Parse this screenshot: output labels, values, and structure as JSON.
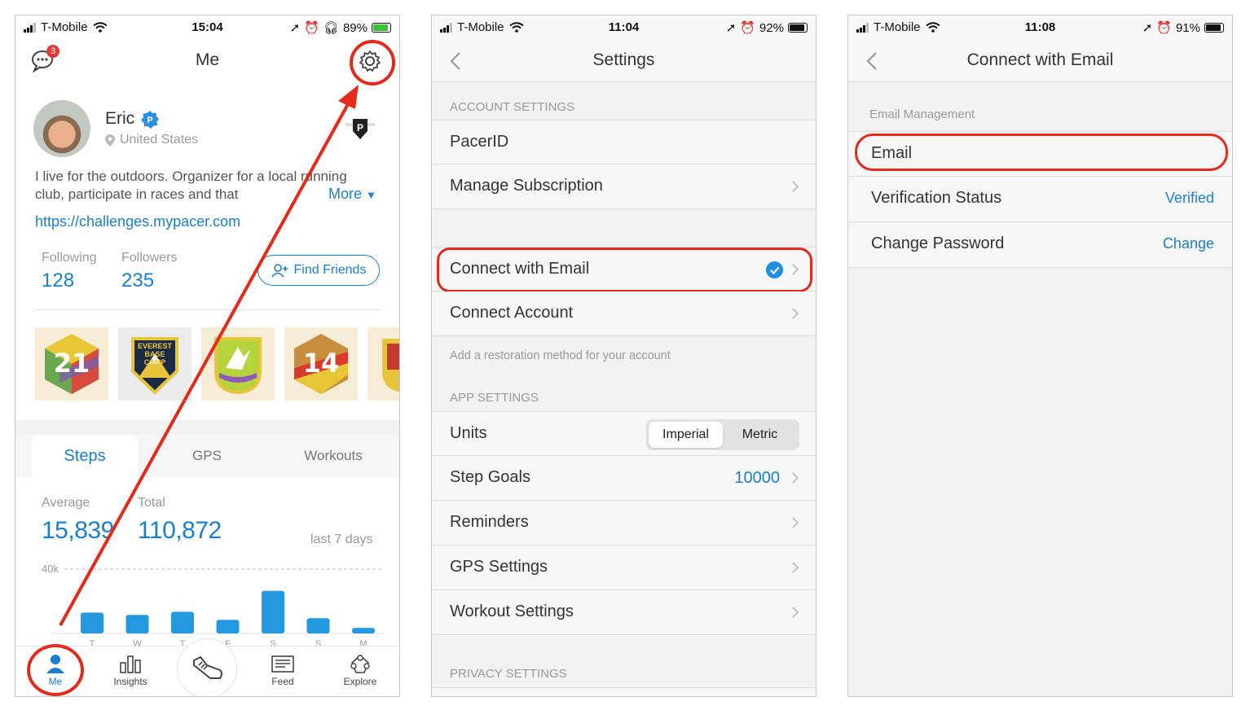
{
  "phone1": {
    "status": {
      "carrier": "T-Mobile",
      "time": "15:04",
      "battery": "89%"
    },
    "title": "Me",
    "messages_badge": "3",
    "profile": {
      "name": "Eric",
      "location": "United States",
      "bio": "I live for the outdoors. Organizer for a local running club, participate in races and that",
      "more": "More",
      "link": "https://challenges.mypacer.com"
    },
    "following_label": "Following",
    "following_value": "128",
    "followers_label": "Followers",
    "followers_value": "235",
    "find_friends": "Find Friends",
    "badges": [
      "21",
      "EVEREST BASE CAMP",
      "",
      "14",
      ""
    ],
    "tabs": [
      "Steps",
      "GPS",
      "Workouts"
    ],
    "average_label": "Average",
    "average_value": "15,839",
    "total_label": "Total",
    "total_value": "110,872",
    "period": "last 7 days",
    "chart_y_label": "40k",
    "tabbar": [
      "Me",
      "Insights",
      "Feed",
      "Explore"
    ],
    "accent": "#1b7fd0",
    "highlight": "#e32a1b"
  },
  "chart_data": {
    "type": "bar",
    "categories": [
      "T",
      "W",
      "T",
      "F",
      "S",
      "S",
      "M"
    ],
    "values": [
      13000,
      11500,
      13500,
      8500,
      26500,
      9500,
      3500
    ],
    "ylim": [
      0,
      40000
    ],
    "gridline": "40k"
  },
  "phone2": {
    "status": {
      "carrier": "T-Mobile",
      "time": "11:04",
      "battery": "92%"
    },
    "title": "Settings",
    "account_header": "ACCOUNT SETTINGS",
    "pacer_id": "PacerID",
    "manage_subscription": "Manage Subscription",
    "connect_email": "Connect with Email",
    "connect_account": "Connect Account",
    "restore_note": "Add a restoration method for your account",
    "app_header": "APP SETTINGS",
    "units": "Units",
    "units_options": [
      "Imperial",
      "Metric"
    ],
    "step_goals": "Step Goals",
    "step_goals_value": "10000",
    "reminders": "Reminders",
    "gps_settings": "GPS Settings",
    "workout_settings": "Workout Settings",
    "privacy_header": "PRIVACY SETTINGS"
  },
  "phone3": {
    "status": {
      "carrier": "T-Mobile",
      "time": "11:08",
      "battery": "91%"
    },
    "title": "Connect with Email",
    "section_header": "Email Management",
    "email": "Email",
    "verification_status": "Verification Status",
    "verification_value": "Verified",
    "change_password": "Change Password",
    "change_password_action": "Change"
  }
}
